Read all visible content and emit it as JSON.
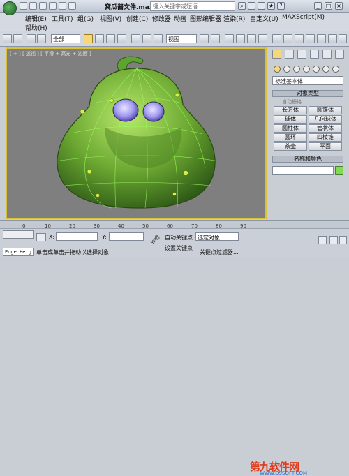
{
  "title_bar": {
    "file_title": "窝瓜酱文件.max",
    "search_placeholder": "键入关键字或短语"
  },
  "menus": [
    "编辑(E)",
    "工具(T)",
    "组(G)",
    "视图(V)",
    "创建(C)",
    "修改器",
    "动画",
    "图形编辑器",
    "渲染(R)",
    "自定义(U)",
    "MAXScript(M)"
  ],
  "help_menu": "帮助(H)",
  "toolbar": {
    "selection_filter": "全部",
    "reference_coord": "视图"
  },
  "viewport": {
    "label": "[ + ] [ 透视 ] [ 平滑 + 高光 + 边面 ]"
  },
  "command_panel": {
    "category_dropdown": "标准基本体",
    "object_type_header": "对象类型",
    "autogrid_label": "自动栅格",
    "object_buttons": [
      "长方体",
      "圆锥体",
      "球体",
      "几何球体",
      "圆柱体",
      "管状体",
      "圆环",
      "四棱锥",
      "茶壶",
      "平面"
    ],
    "name_color_header": "名称和颜色"
  },
  "trackbar": {
    "ticks": [
      "0",
      "10",
      "20",
      "30",
      "40",
      "50",
      "60",
      "70",
      "80",
      "90"
    ]
  },
  "status": {
    "edge_field": "Edge Heig",
    "prompt": "单击或单击并拖动以选择对象",
    "x_label": "X:",
    "y_label": "Y:",
    "auto_key": "自动关键点",
    "set_key": "设置关键点",
    "selected_dropdown": "选定对象",
    "key_filters": "关键点过滤器..."
  },
  "watermark": {
    "brand": "第九软件网",
    "url": "WWW.D9SOFT.COM"
  },
  "colors": {
    "object_color": "#7fdd52",
    "viewport_border": "#d8c23a",
    "viewport_bg": "#7f7f7f"
  }
}
